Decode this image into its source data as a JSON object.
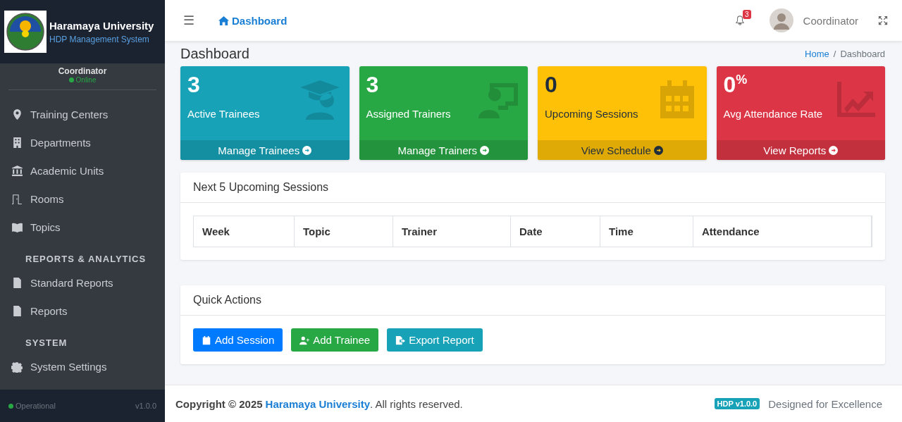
{
  "brand": {
    "title": "Haramaya University",
    "subtitle": "HDP Management System"
  },
  "sidebar": {
    "user": "Coordinator",
    "status": "Online",
    "sections": [
      {
        "items": [
          {
            "label": "Training Centers"
          },
          {
            "label": "Departments"
          },
          {
            "label": "Academic Units"
          },
          {
            "label": "Rooms"
          },
          {
            "label": "Topics"
          }
        ]
      },
      {
        "heading": "REPORTS & ANALYTICS",
        "items": [
          {
            "label": "Standard Reports"
          },
          {
            "label": "Reports"
          }
        ]
      },
      {
        "heading": "SYSTEM",
        "items": [
          {
            "label": "System Settings"
          }
        ]
      }
    ],
    "footer_status": "Operational",
    "version": "v1.0.0"
  },
  "header": {
    "menu": "☰",
    "tab": "Dashboard",
    "notifications": "3",
    "user": "Coordinator"
  },
  "page": {
    "title": "Dashboard",
    "breadcrumb": [
      "Home",
      "Dashboard"
    ],
    "separator": "/"
  },
  "cards": [
    {
      "value": "3",
      "label": "Active Trainees",
      "link": "Manage Trainees",
      "color": "#17a2b8"
    },
    {
      "value": "3",
      "label": "Assigned Trainers",
      "link": "Manage Trainers",
      "color": "#28a745"
    },
    {
      "value": "0",
      "label": "Upcoming Sessions",
      "link": "View Schedule",
      "color": "#ffc107"
    },
    {
      "value": "0$^{%}$",
      "label": "Avg Attendance Rate",
      "link": "View Reports",
      "color": "#dc3545"
    }
  ],
  "sessions": {
    "title": "Next 5 Upcoming Sessions",
    "columns": [
      "Week",
      "Topic",
      "Trainer",
      "Date",
      "Time",
      "Attendance"
    ]
  },
  "quick_actions": {
    "title": "Quick Actions",
    "buttons": [
      {
        "label": "Add Session",
        "color": "#007bff"
      },
      {
        "label": "Add Trainee",
        "color": "#28a745"
      },
      {
        "label": "Export Report",
        "color": "#17a2b8"
      }
    ]
  },
  "footer": {
    "copyright": "Copyright © 2025",
    "org": "Haramaya University",
    "rights": ". All rights reserved.",
    "badge": "HDP v1.0.0",
    "tagline": "Designed for Excellence"
  }
}
